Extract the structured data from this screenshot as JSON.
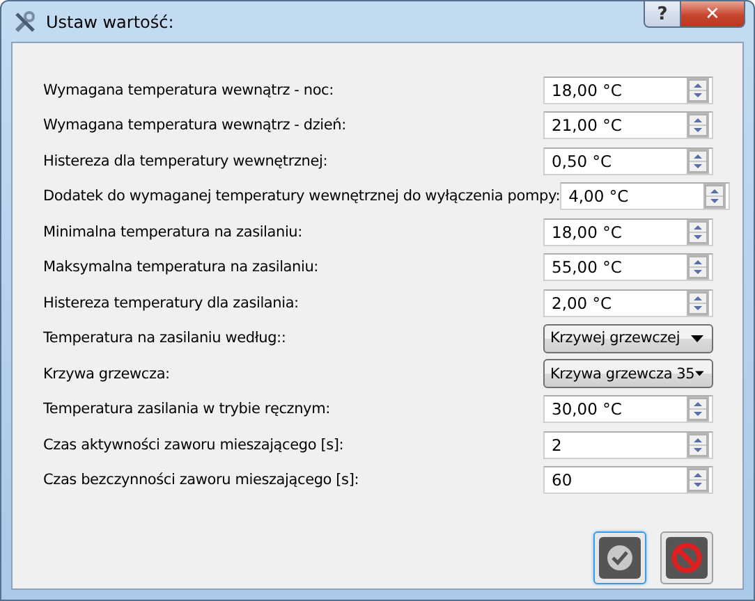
{
  "window": {
    "title": "Ustaw wartość:",
    "help": "?",
    "close": "✕"
  },
  "settings": [
    {
      "label": "Wymagana temperatura wewnątrz - noc:",
      "kind": "spin",
      "value": "18,00 °C"
    },
    {
      "label": "Wymagana temperatura wewnątrz - dzień:",
      "kind": "spin",
      "value": "21,00 °C"
    },
    {
      "label": "Histereza dla temperatury wewnętrznej:",
      "kind": "spin",
      "value": "0,50 °C"
    },
    {
      "label": "Dodatek do wymaganej temperatury wewnętrznej do wyłączenia pompy:",
      "kind": "spin",
      "value": "4,00 °C"
    },
    {
      "label": "Minimalna temperatura na zasilaniu:",
      "kind": "spin",
      "value": "18,00 °C"
    },
    {
      "label": "Maksymalna temperatura na zasilaniu:",
      "kind": "spin",
      "value": "55,00 °C"
    },
    {
      "label": "Histereza temperatury dla zasilania:",
      "kind": "spin",
      "value": "2,00 °C"
    },
    {
      "label": "Temperatura na zasilaniu według::",
      "kind": "combo",
      "value": "Krzywej grzewczej"
    },
    {
      "label": "Krzywa grzewcza:",
      "kind": "combo",
      "value": "Krzywa grzewcza 35"
    },
    {
      "label": "Temperatura zasilania w trybie ręcznym:",
      "kind": "spin",
      "value": "30,00 °C"
    },
    {
      "label": "Czas aktywności zaworu mieszającego [s]:",
      "kind": "spin",
      "value": "2"
    },
    {
      "label": "Czas bezczynności zaworu mieszającego [s]:",
      "kind": "spin",
      "value": "60"
    }
  ]
}
